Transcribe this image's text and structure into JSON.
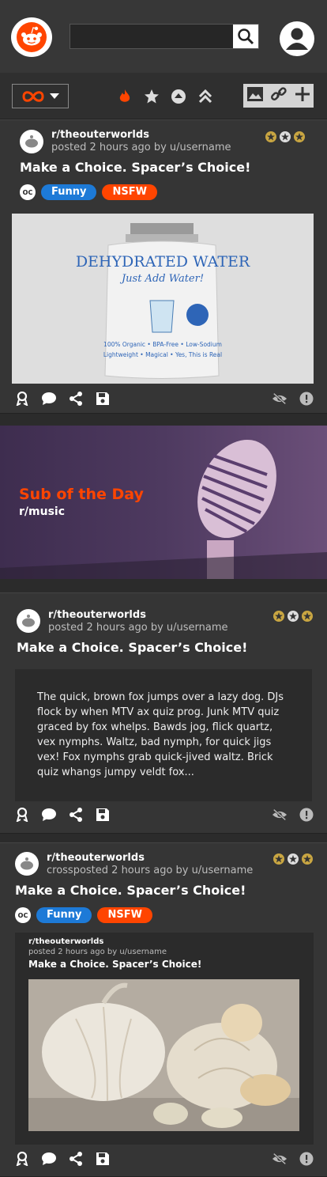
{
  "search": {
    "placeholder": ""
  },
  "posts": [
    {
      "subreddit": "r/theouterworlds",
      "meta": "posted 2 hours ago by u/username",
      "title": "Make a Choice. Spacer’s Choice!",
      "oc": "OC",
      "tags": [
        "Funny",
        "NSFW"
      ],
      "image_caption": {
        "line1": "DEHYDRATED WATER",
        "line2": "Just Add Water!",
        "fine": "100% Organic • BPA-Free • Low-Sodium",
        "fine2": "Lightweight • Magical • Yes, This is Real"
      }
    },
    {
      "subreddit": "r/theouterworlds",
      "meta": "posted 2 hours ago by u/username",
      "title": "Make a Choice. Spacer’s Choice!",
      "body": "The quick, brown fox jumps over a lazy dog. DJs flock by when MTV ax quiz prog. Junk MTV quiz graced by fox whelps. Bawds jog, flick quartz, vex nymphs. Waltz, bad nymph, for quick jigs vex! Fox nymphs grab quick-jived waltz. Brick quiz whangs jumpy veldt fox..."
    },
    {
      "subreddit": "r/theouterworlds",
      "meta": "crossposted 2 hours ago by u/username",
      "title": "Make a Choice. Spacer’s Choice!",
      "oc": "OC",
      "tags": [
        "Funny",
        "NSFW"
      ],
      "crosspost": {
        "subreddit": "r/theouterworlds",
        "meta": "posted 2 hours ago by u/username",
        "title": "Make a Choice. Spacer’s Choice!"
      }
    }
  ],
  "banner": {
    "heading": "Sub of the Day",
    "subreddit": "r/music"
  },
  "colors": {
    "accent": "#ff4500",
    "funny": "#1d7ad7",
    "nsfw": "#ff4500",
    "card": "#353535",
    "bg": "#2b2b2b"
  }
}
